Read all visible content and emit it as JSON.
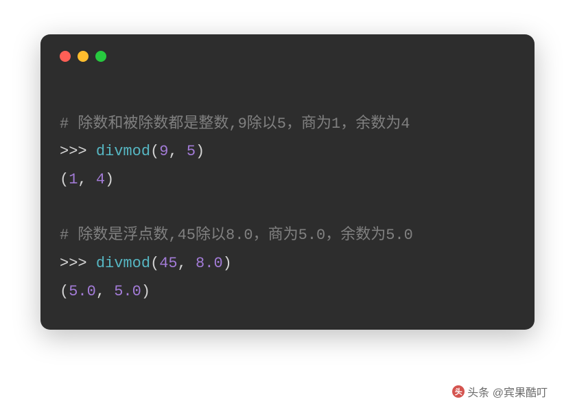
{
  "code": {
    "line1_comment": "# 除数和被除数都是整数,9除以5，商为1，余数为4",
    "line2_prompt": ">>> ",
    "line2_func": "divmod",
    "line2_open": "(",
    "line2_arg1": "9",
    "line2_comma": ", ",
    "line2_arg2": "5",
    "line2_close": ")",
    "line3_open": "(",
    "line3_v1": "1",
    "line3_comma": ", ",
    "line3_v2": "4",
    "line3_close": ")",
    "line4_comment": "# 除数是浮点数,45除以8.0，商为5.0，余数为5.0",
    "line5_prompt": ">>> ",
    "line5_func": "divmod",
    "line5_open": "(",
    "line5_arg1": "45",
    "line5_comma": ", ",
    "line5_arg2": "8.0",
    "line5_close": ")",
    "line6_open": "(",
    "line6_v1": "5.0",
    "line6_comma": ", ",
    "line6_v2": "5.0",
    "line6_close": ")"
  },
  "watermark": {
    "text": "头条 @宾果酷叮"
  }
}
